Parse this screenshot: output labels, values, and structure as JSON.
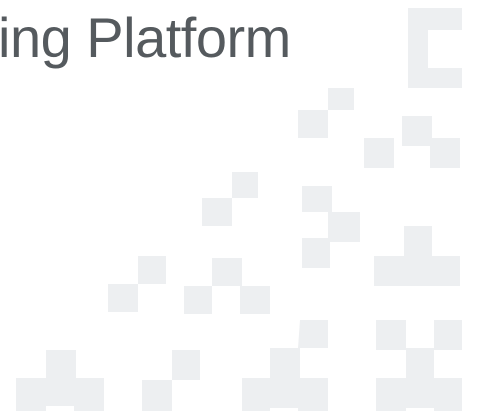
{
  "slide": {
    "title": "ing Platform",
    "title_color": "#555a5e",
    "pattern_color": "#edeff1",
    "background_color": "#ffffff"
  }
}
